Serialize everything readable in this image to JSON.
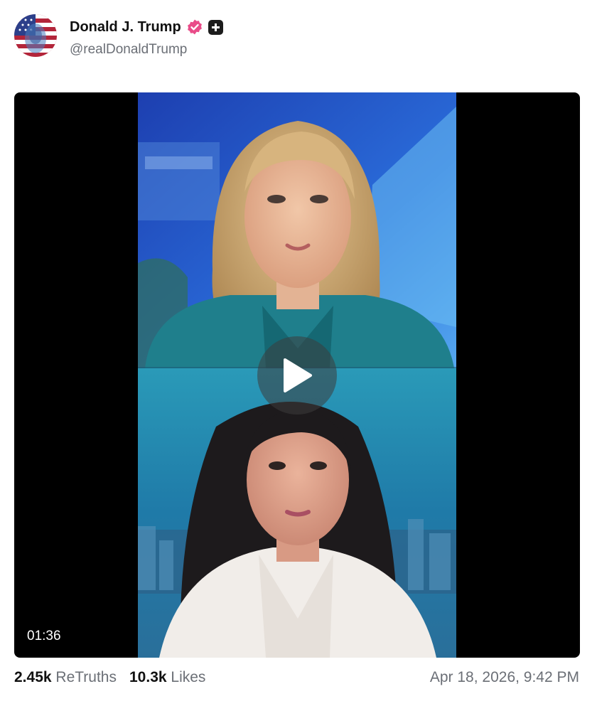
{
  "author": {
    "display_name": "Donald J. Trump",
    "handle": "@realDonaldTrump",
    "avatar_icon": "flag-portrait-avatar",
    "verified_icon": "verified-badge-icon",
    "verified_color": "#e94c89",
    "plus_icon": "plus-badge-icon"
  },
  "video": {
    "duration": "01:36",
    "play_icon": "play-icon"
  },
  "stats": {
    "retruths_count": "2.45k",
    "retruths_label": "ReTruths",
    "likes_count": "10.3k",
    "likes_label": "Likes"
  },
  "timestamp": "Apr 18, 2026, 9:42 PM"
}
